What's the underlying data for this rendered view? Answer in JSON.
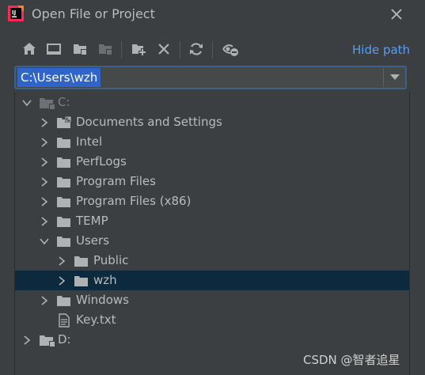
{
  "window": {
    "title": "Open File or Project"
  },
  "toolbar": {
    "buttons": [
      {
        "icon": "home-icon"
      },
      {
        "icon": "desktop-icon"
      },
      {
        "icon": "project-folder-icon"
      },
      {
        "icon": "module-folder-icon"
      },
      {
        "icon": "new-folder-icon"
      },
      {
        "icon": "delete-icon"
      },
      {
        "icon": "refresh-icon"
      },
      {
        "icon": "show-hidden-icon"
      }
    ],
    "hide_path_label": "Hide path"
  },
  "path": {
    "value": "C:\\Users\\wzh"
  },
  "tree": {
    "drive_c": "C:",
    "items": [
      {
        "label": "Documents and Settings"
      },
      {
        "label": "Intel"
      },
      {
        "label": "PerfLogs"
      },
      {
        "label": "Program Files"
      },
      {
        "label": "Program Files (x86)"
      },
      {
        "label": "TEMP"
      },
      {
        "label": "Users"
      },
      {
        "label": "Public"
      },
      {
        "label": "wzh"
      },
      {
        "label": "Windows"
      },
      {
        "label": "Key.txt"
      }
    ],
    "drive_d": "D:"
  },
  "watermark": "CSDN @智者追星",
  "colors": {
    "background": "#3c3f41",
    "selection": "#0d293e",
    "path_highlight": "#2f65ca",
    "link": "#589df6"
  }
}
